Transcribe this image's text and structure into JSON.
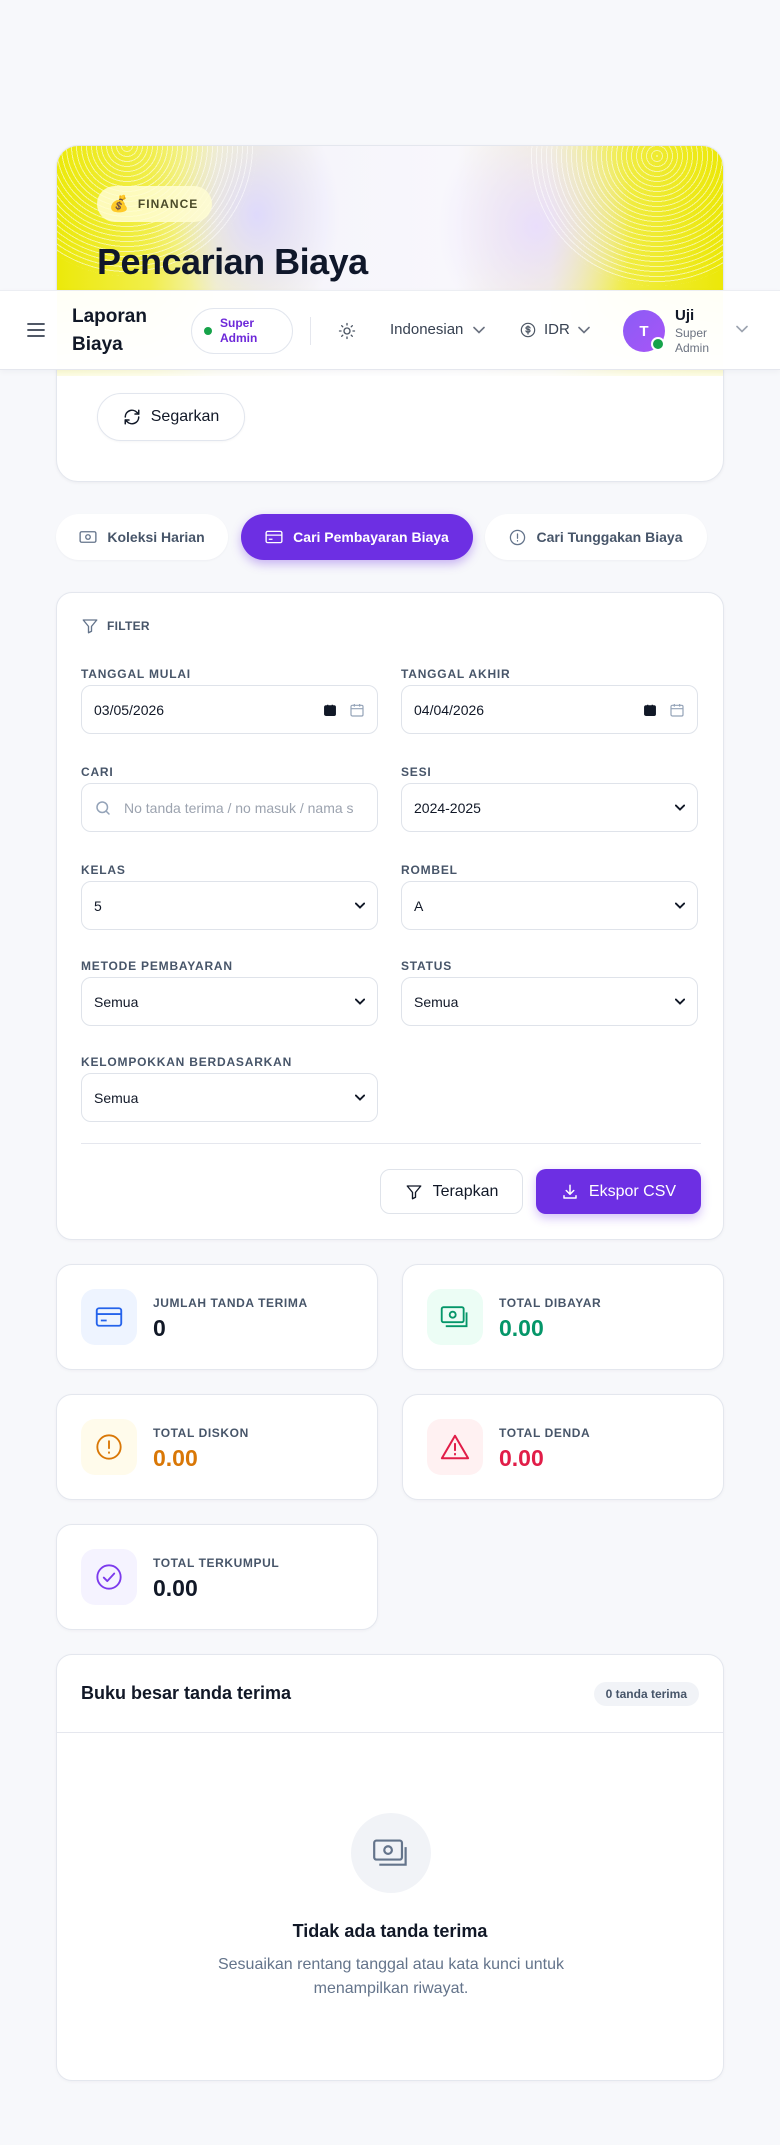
{
  "hero": {
    "badge": "FINANCE",
    "title": "Pencarian Biaya",
    "refresh_label": "Segarkan"
  },
  "topbar": {
    "title": "Laporan Biaya",
    "role": "Super Admin",
    "language": "Indonesian",
    "currency": "IDR",
    "user": {
      "initial": "T",
      "name": "Uji",
      "role": "Super Admin"
    }
  },
  "tabs": [
    {
      "label": "Koleksi Harian",
      "icon": "cash-icon",
      "active": false
    },
    {
      "label": "Cari Pembayaran Biaya",
      "icon": "card-icon",
      "active": true
    },
    {
      "label": "Cari Tunggakan Biaya",
      "icon": "alert-circle-icon",
      "active": false
    }
  ],
  "filter": {
    "heading": "FILTER",
    "start_date": {
      "label": "TANGGAL MULAI",
      "value": "03/05/2026"
    },
    "end_date": {
      "label": "TANGGAL AKHIR",
      "value": "04/04/2026"
    },
    "search": {
      "label": "CARI",
      "placeholder": "No tanda terima / no masuk / nama s"
    },
    "session": {
      "label": "SESI",
      "value": "2024-2025"
    },
    "class": {
      "label": "KELAS",
      "value": "5"
    },
    "rombel": {
      "label": "ROMBEL",
      "value": "A"
    },
    "payment_method": {
      "label": "METODE PEMBAYARAN",
      "value": "Semua"
    },
    "status": {
      "label": "STATUS",
      "value": "Semua"
    },
    "group_by": {
      "label": "KELOMPOKKAN BERDASARKAN",
      "value": "Semua"
    },
    "apply_label": "Terapkan",
    "export_label": "Ekspor CSV"
  },
  "stats": [
    {
      "label": "JUMLAH TANDA TERIMA",
      "value": "0",
      "icon": "card-icon",
      "color": "#111827",
      "bg": "#eef4ff",
      "icon_color": "#2563eb"
    },
    {
      "label": "TOTAL DIBAYAR",
      "value": "0.00",
      "icon": "cash-icon",
      "color": "#059669",
      "bg": "#ecfdf5",
      "icon_color": "#059669"
    },
    {
      "label": "TOTAL DISKON",
      "value": "0.00",
      "icon": "alert-circle-icon",
      "color": "#d97706",
      "bg": "#fffbeb",
      "icon_color": "#d97706"
    },
    {
      "label": "TOTAL DENDA",
      "value": "0.00",
      "icon": "warning-triangle-icon",
      "color": "#e11d48",
      "bg": "#fff1f2",
      "icon_color": "#e11d48"
    },
    {
      "label": "TOTAL TERKUMPUL",
      "value": "0.00",
      "icon": "check-circle-icon",
      "color": "#111827",
      "bg": "#f5f3ff",
      "icon_color": "#7c3aed"
    }
  ],
  "ledger": {
    "title": "Buku besar tanda terima",
    "count": "0 tanda terima",
    "empty_title": "Tidak ada tanda terima",
    "empty_desc": "Sesuaikan rentang tanggal atau kata kunci untuk menampilkan riwayat."
  },
  "colors": {
    "accent": "#6d2fe3",
    "success": "#16a34a"
  }
}
